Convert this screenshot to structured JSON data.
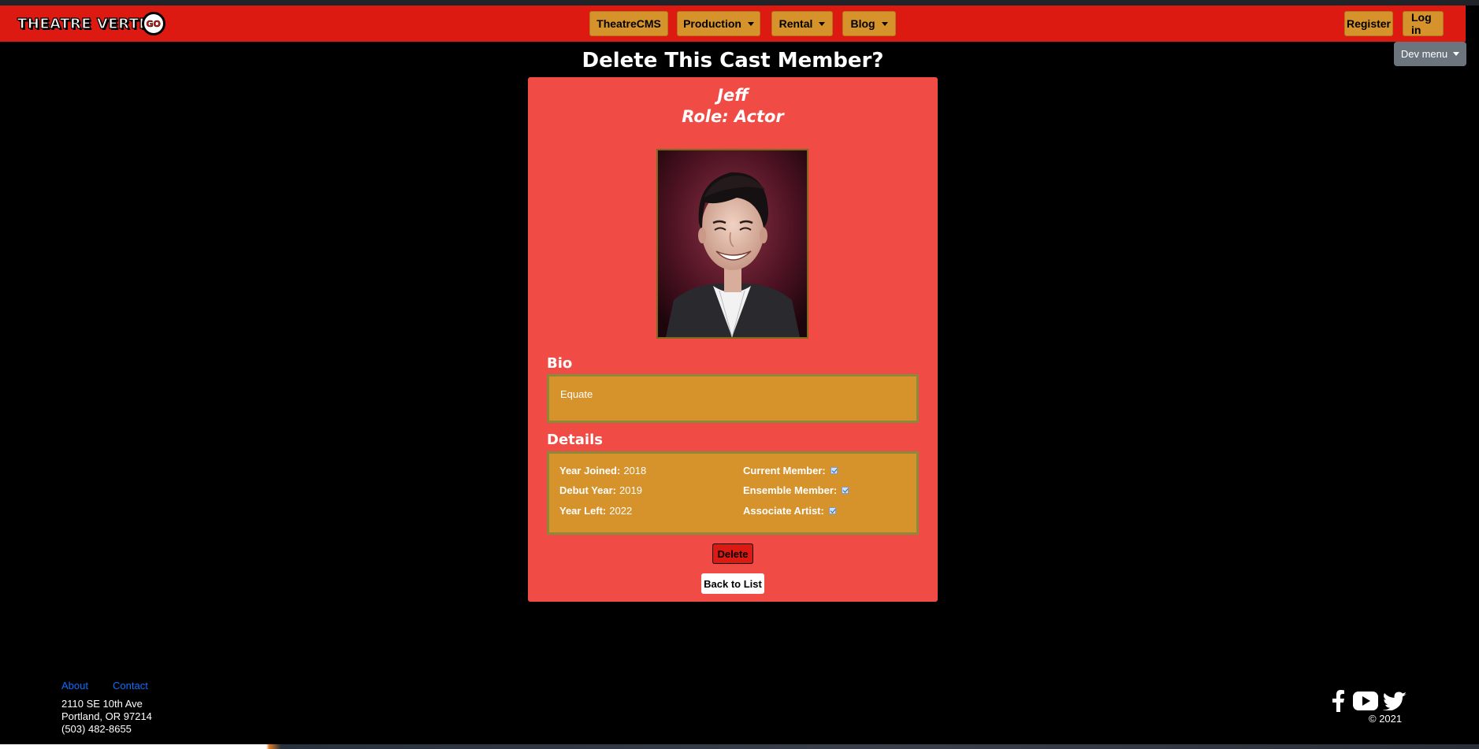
{
  "brand": {
    "text": "THEATRE VERTI",
    "go": "GO"
  },
  "nav": {
    "theatrecms": "TheatreCMS",
    "production": "Production",
    "rental": "Rental",
    "blog": "Blog",
    "register": "Register",
    "login": "Log in",
    "dev_menu": "Dev menu"
  },
  "page": {
    "title": "Delete This Cast Member?"
  },
  "member": {
    "name": "Jeff",
    "role": "Role: Actor",
    "bio_heading": "Bio",
    "bio": "Equate",
    "details_heading": "Details",
    "details": {
      "year_joined_label": "Year Joined:",
      "year_joined": "2018",
      "debut_year_label": "Debut Year:",
      "debut_year": "2019",
      "year_left_label": "Year Left:",
      "year_left": "2022",
      "current_member_label": "Current Member:",
      "current_member": true,
      "ensemble_member_label": "Ensemble Member:",
      "ensemble_member": true,
      "associate_artist_label": "Associate Artist:",
      "associate_artist": true
    }
  },
  "actions": {
    "delete": "Delete",
    "back": "Back to List"
  },
  "footer": {
    "about": "About",
    "contact": "Contact",
    "address_line1": "2110 SE 10th Ave",
    "address_line2": "Portland, OR 97214",
    "phone": "(503) 482-8655",
    "copyright": "© 2021",
    "social": [
      "facebook-icon",
      "youtube-icon",
      "twitter-icon"
    ]
  },
  "colors": {
    "navbar": "#dc1a12",
    "nav_button": "#d6922b",
    "card": "#f04c45",
    "box": "#d6922b",
    "link": "#0d6efd"
  }
}
